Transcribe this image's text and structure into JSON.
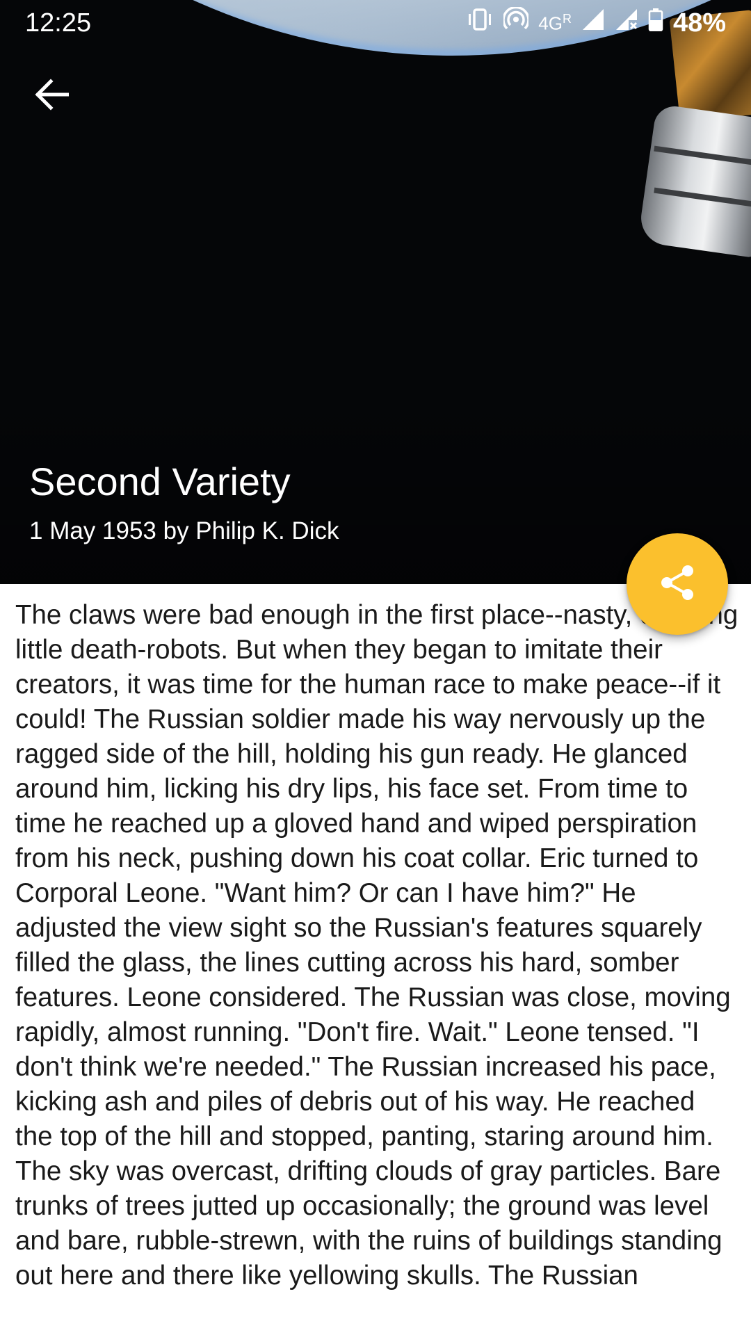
{
  "status_bar": {
    "time": "12:25",
    "network": "4G",
    "network_roaming": "R",
    "battery": "48%"
  },
  "toolbar": {
    "back_icon": "arrow-back-icon"
  },
  "story": {
    "title": "Second Variety",
    "byline": "1 May 1953 by Philip K. Dick",
    "text": "The claws were bad enough in the first place--nasty, crawling little death-robots. But when they began to imitate their creators, it was time for the human race to make peace--if it could! The Russian soldier made his way nervously up the ragged side of the hill, holding his gun ready. He glanced around him, licking his dry lips, his face set. From time to time he reached up a gloved hand and wiped perspiration from his neck, pushing down his coat collar. Eric turned to Corporal Leone. \"Want him? Or can I have him?\" He adjusted the view sight so the Russian's features squarely filled the glass, the lines cutting across his hard, somber features. Leone considered. The Russian was close, moving rapidly, almost running. \"Don't fire. Wait.\" Leone tensed. \"I don't think we're needed.\" The Russian increased his pace, kicking ash and piles of debris out of his way. He reached the top of the hill and stopped, panting, staring around him. The sky was overcast, drifting clouds of gray particles. Bare trunks of trees jutted up occasionally; the ground was level and bare, rubble-strewn, with the ruins of buildings standing out here and there like yellowing skulls. The Russian"
  },
  "fab": {
    "icon": "share-icon",
    "color": "#fbc02d"
  }
}
